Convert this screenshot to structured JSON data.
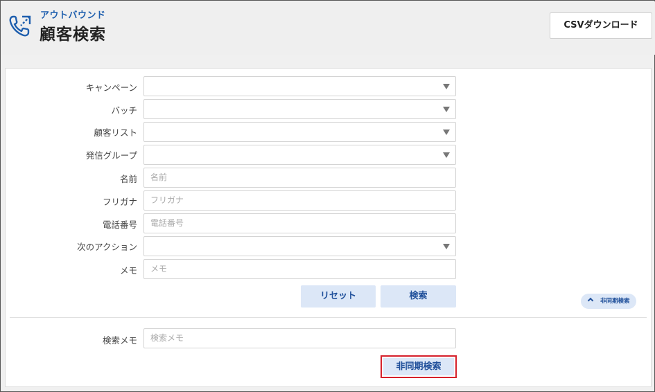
{
  "header": {
    "subtitle": "アウトバウンド",
    "title": "顧客検索",
    "icon": "phone-outbound-icon",
    "csv_button": "CSVダウンロード"
  },
  "form": {
    "campaign": {
      "label": "キャンペーン",
      "value": ""
    },
    "batch": {
      "label": "バッチ",
      "value": ""
    },
    "customer_list": {
      "label": "顧客リスト",
      "value": ""
    },
    "caller_group": {
      "label": "発信グループ",
      "value": ""
    },
    "name": {
      "label": "名前",
      "placeholder": "名前"
    },
    "furigana": {
      "label": "フリガナ",
      "placeholder": "フリガナ"
    },
    "phone": {
      "label": "電話番号",
      "placeholder": "電話番号"
    },
    "next_action": {
      "label": "次のアクション",
      "value": ""
    },
    "memo": {
      "label": "メモ",
      "placeholder": "メモ"
    },
    "reset_button": "リセット",
    "search_button": "検索",
    "async_toggle": "非同期検索"
  },
  "async": {
    "search_memo": {
      "label": "検索メモ",
      "placeholder": "検索メモ"
    },
    "async_search_button": "非同期検索"
  },
  "colors": {
    "accent": "#1f5fae",
    "button_bg": "#dce7f7",
    "highlight_border": "#d6202a"
  }
}
